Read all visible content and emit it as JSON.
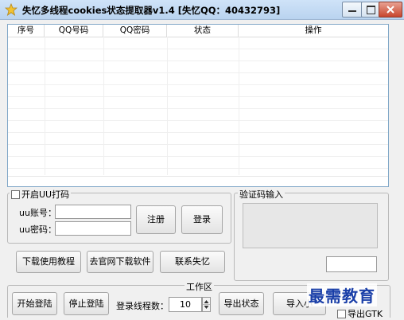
{
  "window": {
    "title": "失忆多线程cookies状态提取器v1.4    [失忆QQ：40432793]",
    "minimize_glyph": "—",
    "maximize_glyph": "☐",
    "close_glyph": "✕",
    "icon": "star-icon"
  },
  "table": {
    "columns": [
      "序号",
      "QQ号码",
      "QQ密码",
      "状态",
      "操作"
    ],
    "rows": []
  },
  "login_panel": {
    "enable_checkbox_label": "开启UU打码",
    "enable_checked": false,
    "uu_account_label": "uu账号：",
    "uu_account_value": "",
    "uu_password_label": "uu密码：",
    "uu_password_value": "",
    "register_label": "注册",
    "login_label": "登录"
  },
  "captcha_panel": {
    "title": "验证码输入",
    "input_value": ""
  },
  "links": {
    "download_tutorial": "下载使用教程",
    "download_software": "去官网下载软件",
    "contact": "联系失忆"
  },
  "work_area": {
    "title": "工作区",
    "start_login": "开始登陆",
    "stop_login": "停止登陆",
    "thread_count_label": "登录线程数：",
    "thread_count_value": "10",
    "export_status": "导出状态",
    "import_partial": "导入小",
    "export_gtk_label": "导出GTK",
    "export_gtk_checked": false
  },
  "watermark": {
    "text": "最需教育"
  }
}
